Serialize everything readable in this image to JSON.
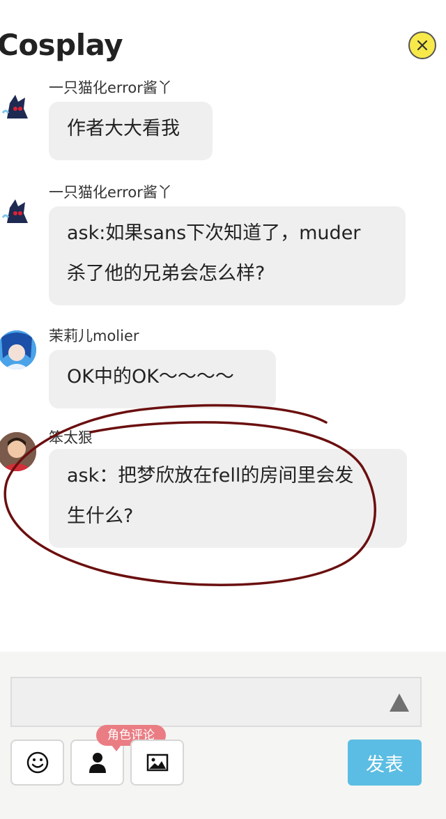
{
  "header": {
    "title": "Cosplay"
  },
  "messages": [
    {
      "sender": "一只猫化error酱丫",
      "text_lines": [
        "作者大大看我"
      ]
    },
    {
      "sender": "一只猫化error酱丫",
      "text_lines": [
        "ask:如果sans下次知道了，muder",
        "杀了他的兄弟会怎么样?"
      ]
    },
    {
      "sender": "茉莉儿molier",
      "text_lines": [
        "OK中的OK～～～～"
      ]
    },
    {
      "sender": "笨太狠",
      "text_lines": [
        "ask：把梦欣放在fell的房间里会发",
        "生什么?"
      ]
    }
  ],
  "composer": {
    "input_value": "",
    "tooltip": "角色评论",
    "post_label": "发表",
    "icons": [
      "smiley-icon",
      "person-icon",
      "image-icon"
    ]
  },
  "colors": {
    "bubble": "#efefef",
    "post_button": "#5bbde3",
    "tooltip": "#ea7d83",
    "close_button": "#f7e94a",
    "annotation_circle": "#6b0f0f"
  }
}
